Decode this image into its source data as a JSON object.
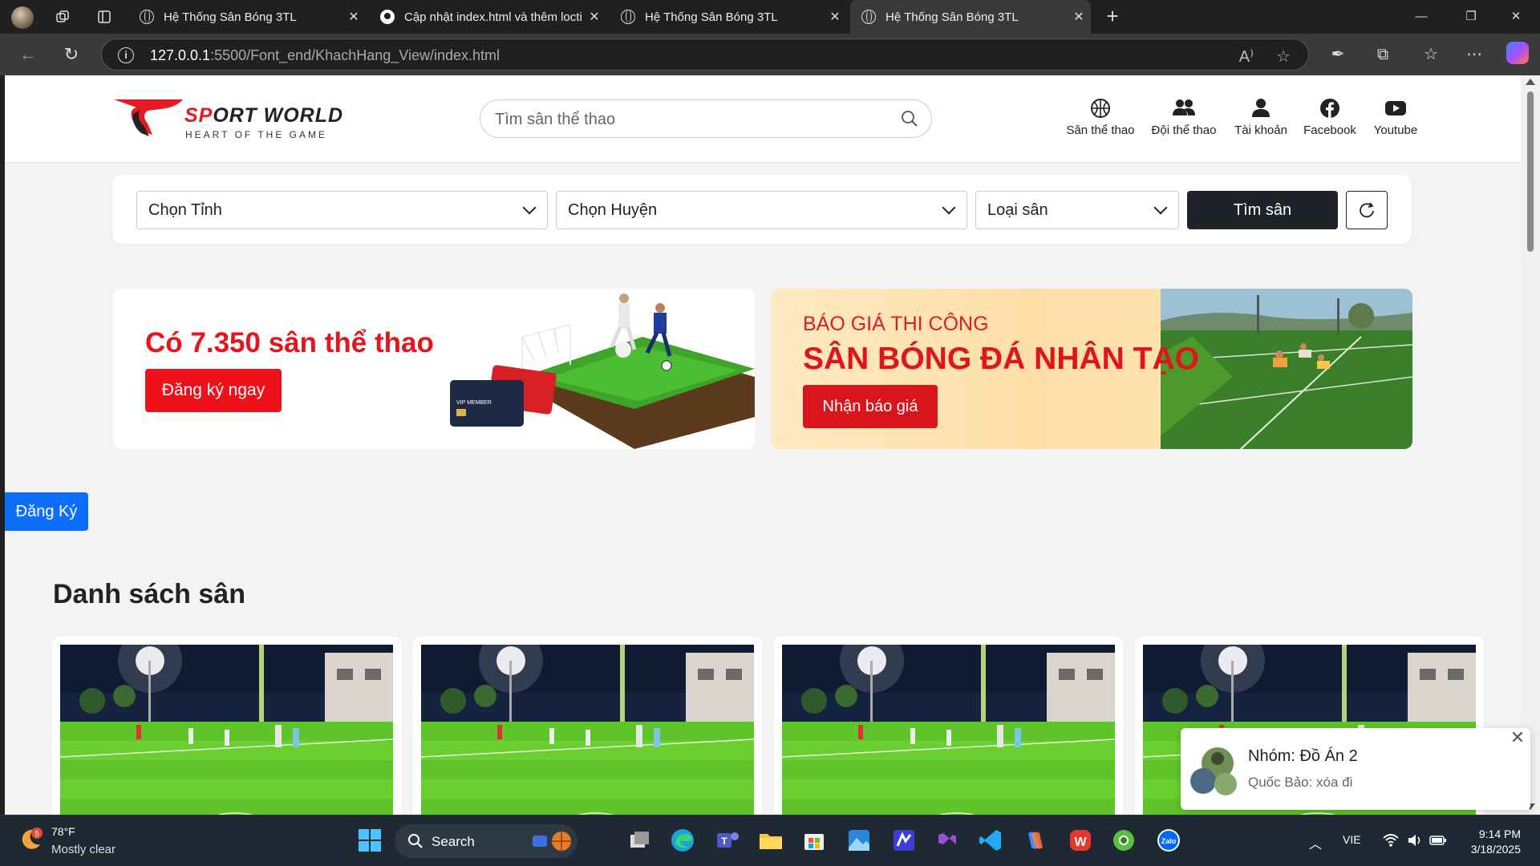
{
  "browser": {
    "tabs": [
      {
        "title": "Hệ Thống Sân Bóng 3TL",
        "active": false,
        "favicon": "globe-icon"
      },
      {
        "title": "Cập nhật index.html và thêm locti",
        "active": false,
        "favicon": "github-icon"
      },
      {
        "title": "Hệ Thống Sân Bóng 3TL",
        "active": false,
        "favicon": "globe-icon"
      },
      {
        "title": "Hệ Thống Sân Bóng 3TL",
        "active": true,
        "favicon": "globe-icon"
      }
    ],
    "url_host": "127.0.0.1",
    "url_rest": ":5500/Font_end/KhachHang_View/index.html"
  },
  "site": {
    "logo_name_a": "SP",
    "logo_name_b": "ORT WORLD",
    "logo_tagline": "HEART OF THE GAME",
    "search_placeholder": "Tìm sân thể thao",
    "nav": [
      {
        "label": "Sân thể thao",
        "icon": "basketball-icon"
      },
      {
        "label": "Đội thể thao",
        "icon": "team-icon"
      },
      {
        "label": "Tài khoản",
        "icon": "user-icon"
      },
      {
        "label": "Facebook",
        "icon": "facebook-icon"
      },
      {
        "label": "Youtube",
        "icon": "youtube-icon"
      }
    ],
    "filter": {
      "province": "Chọn Tỉnh",
      "district": "Chọn Huyện",
      "type": "Loại sân",
      "find": "Tìm sân"
    },
    "banner1": {
      "headline": "Có 7.350 sân thể thao",
      "button": "Đăng ký ngay"
    },
    "banner2": {
      "line1": "BÁO GIÁ THI CÔNG",
      "line2": "SÂN BÓNG ĐÁ NHÂN TẠO",
      "button": "Nhận báo giá"
    },
    "register_button": "Đăng Ký",
    "section_title": "Danh sách sân",
    "chat": {
      "name": "Nhóm: Đồ Án 2",
      "message": "Quốc Bảo: xóa đi"
    }
  },
  "taskbar": {
    "temp": "78°F",
    "weather": "Mostly clear",
    "weather_badge": "5",
    "search": "Search",
    "lang": "VIE",
    "time": "9:14 PM",
    "date": "3/18/2025",
    "zalo_label": "Zalo"
  },
  "colors": {
    "brand_red": "#e8141b",
    "dark_button": "#1f2329",
    "primary_blue": "#0d6efd"
  }
}
